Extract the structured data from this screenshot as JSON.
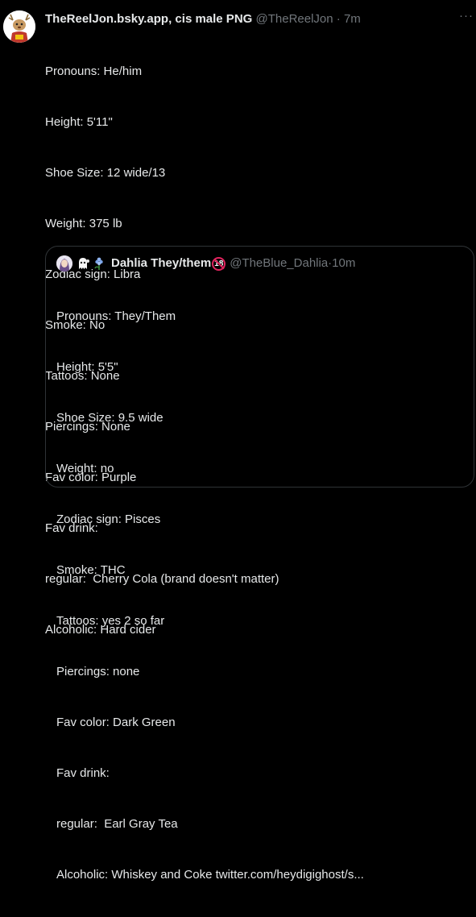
{
  "tweet": {
    "display_name": "TheReelJon.bsky.app, cis male PNG",
    "handle": "@TheReelJon",
    "separator": "·",
    "time": "7m",
    "more_label": "···",
    "lines": [
      "Pronouns: He/him",
      "Height: 5'11\"",
      "Shoe Size: 12 wide/13",
      "Weight: 375 lb",
      "Zodiac sign: Libra",
      "Smoke: No",
      "Tattoos: None",
      "Piercings: None",
      "Fav color: Purple",
      "Fav drink:",
      "regular:  Cherry Cola (brand doesn't matter)",
      "Alcoholic: Hard cider"
    ]
  },
  "quoted_tweet": {
    "display_name": "Dahlia They/them",
    "age_badge": "18",
    "handle": "@TheBlue_Dahlia",
    "separator": "·",
    "time": "10m",
    "lines": [
      "Pronouns: They/Them",
      "Height: 5'5\"",
      "Shoe Size: 9.5 wide",
      "Weight: no",
      "Zodiac sign: Pisces",
      "Smoke: THC",
      "Tattoos: yes 2 so far",
      "Piercings: none",
      "Fav color: Dark Green",
      "Fav drink:",
      "regular:  Earl Gray Tea",
      "Alcoholic: Whiskey and Coke twitter.com/heydigighost/s..."
    ]
  },
  "colors": {
    "background": "#000000",
    "text_primary": "#e7e9ea",
    "text_secondary": "#71767b",
    "border": "#2f3336",
    "badge_red": "#e0245e"
  },
  "icons": [
    "avatar",
    "more-icon",
    "quoted-avatar",
    "ghost-emoji-icon",
    "flower-emoji-icon",
    "age-18-badge-icon"
  ]
}
